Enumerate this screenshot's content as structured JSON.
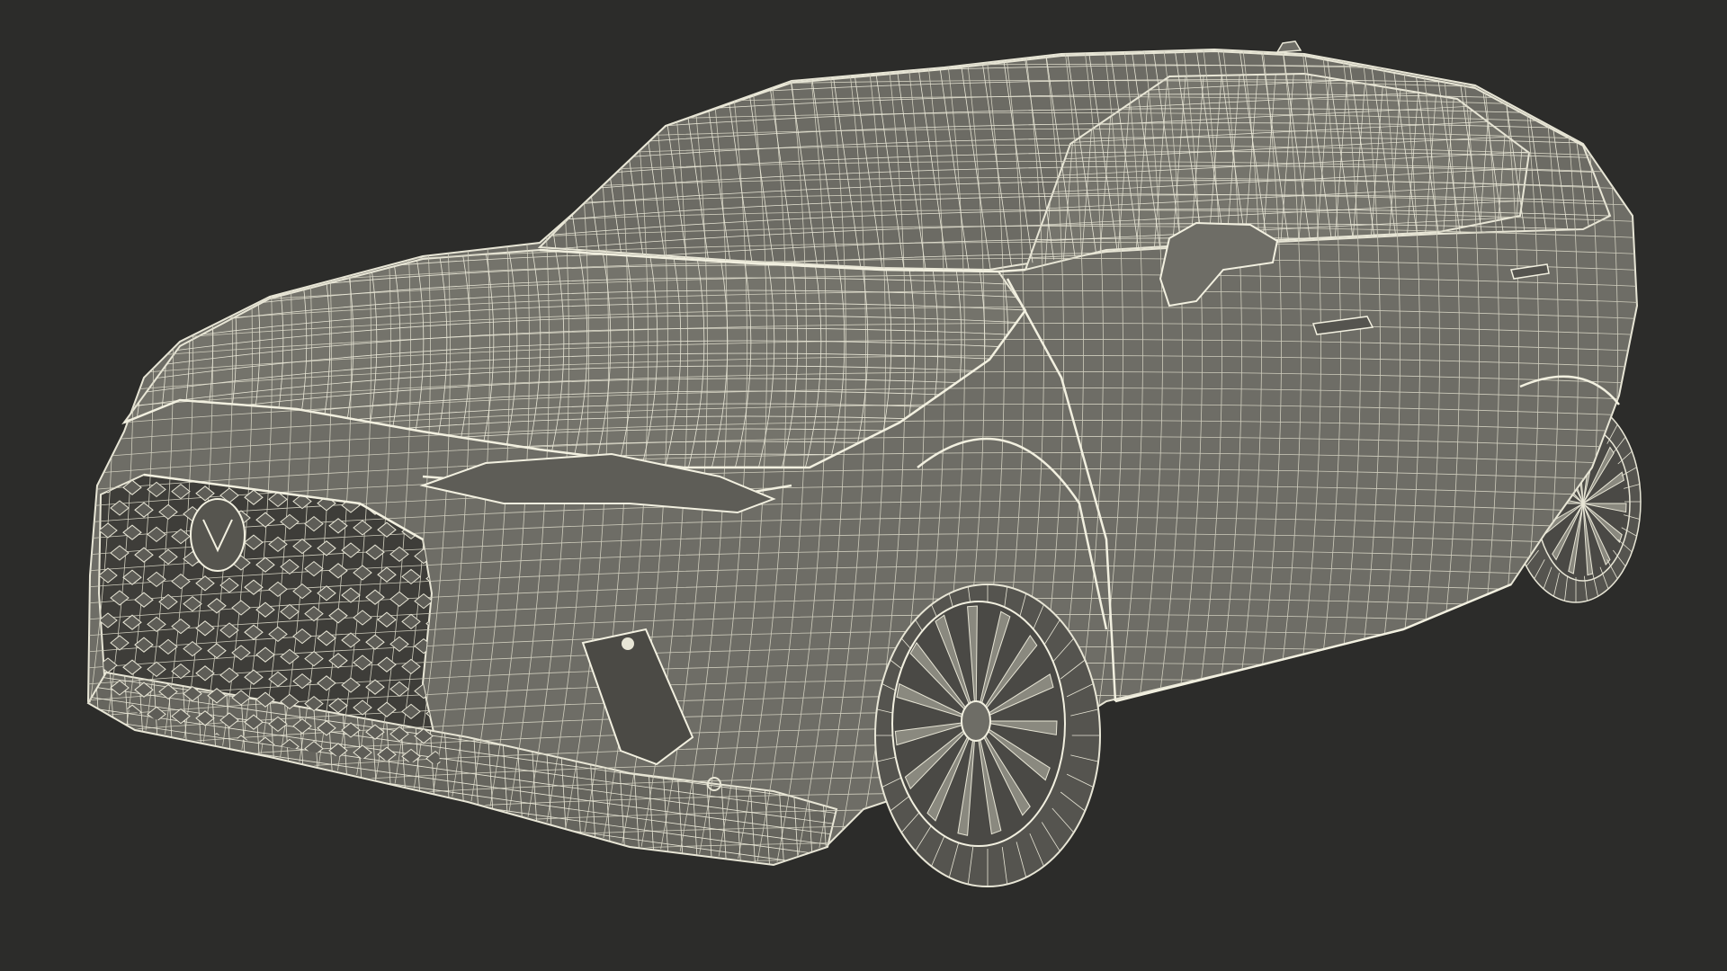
{
  "scene": {
    "subject": "wireframe-suv",
    "colors": {
      "background": "#2c2c2a",
      "body_fill": "#6e6d66",
      "body_shade": "#5a5953",
      "wire": "#e8e6d6",
      "wire_dim": "#cfcdbd",
      "tire": "#55544f",
      "window": "#7a7971"
    }
  }
}
